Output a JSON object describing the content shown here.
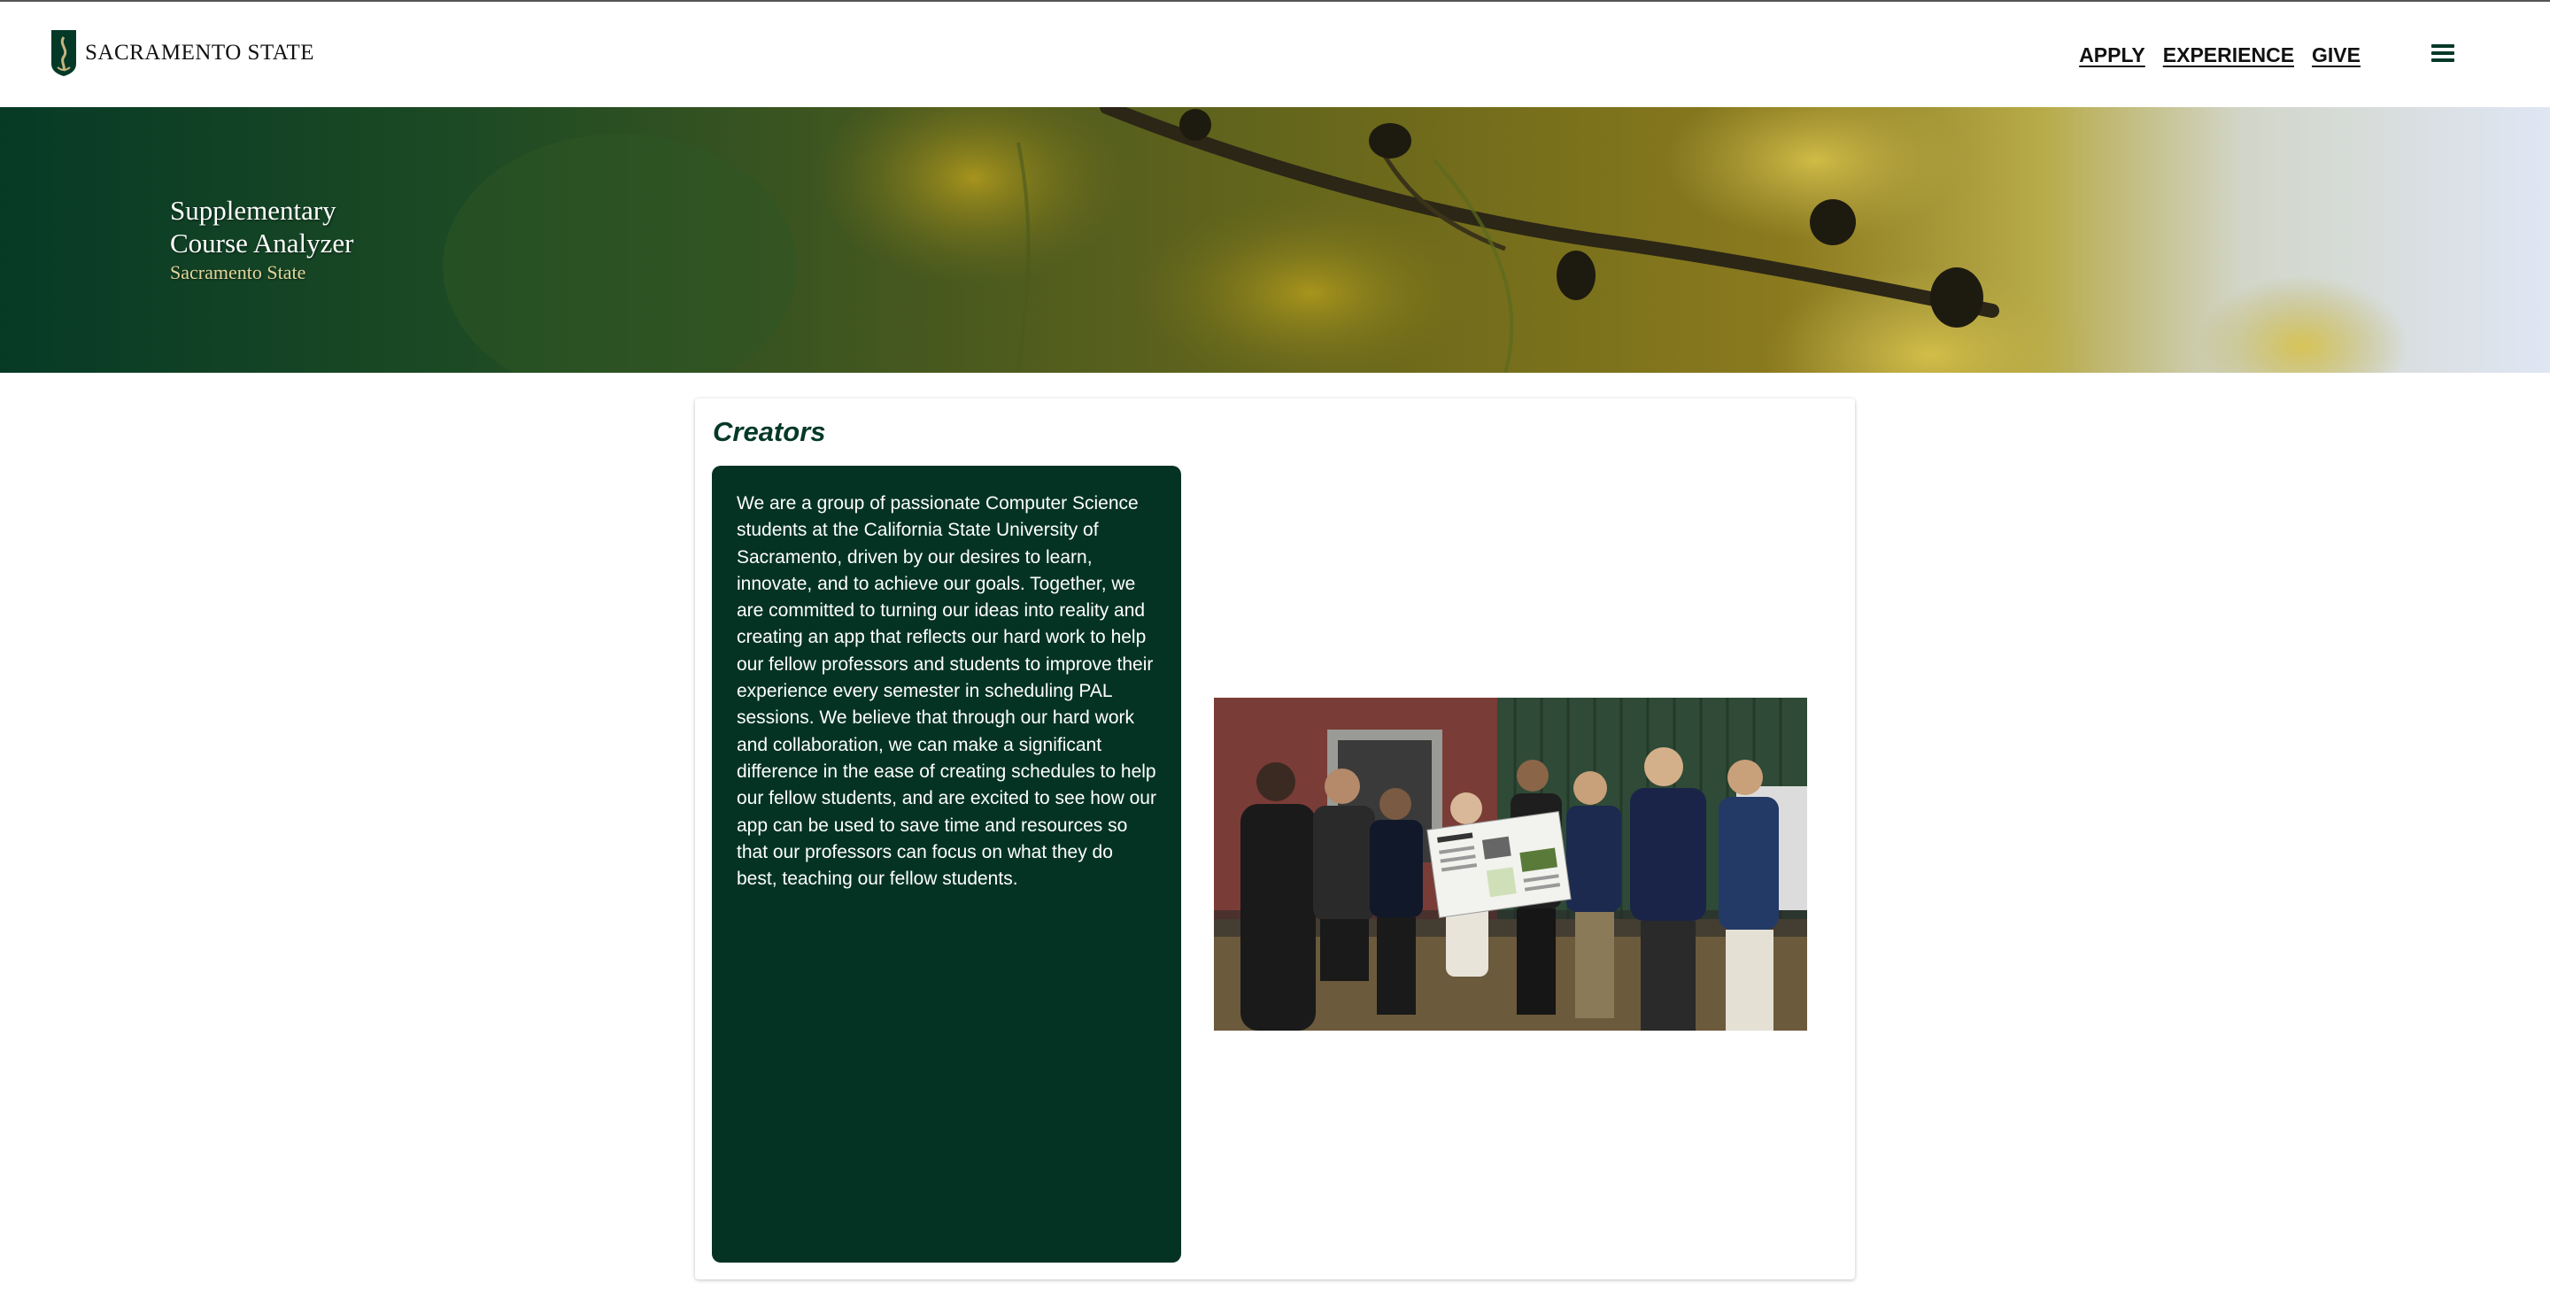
{
  "header": {
    "logo_text": "SACRAMENTO STATE",
    "nav": [
      {
        "label": "APPLY"
      },
      {
        "label": "EXPERIENCE"
      },
      {
        "label": "GIVE"
      }
    ],
    "menu_icon": "hamburger-menu-icon"
  },
  "hero": {
    "title": "Supplementary Course Analyzer",
    "subtitle": "Sacramento State"
  },
  "creators": {
    "heading": "Creators",
    "body": "We are a group of passionate Computer Science students at the California State University of Sacramento, driven by our desires to learn, innovate, and to achieve our goals. Together, we are committed to turning our ideas into reality and creating an app that reflects our hard work to help our fellow professors and students to improve their experience every semester in scheduling PAL sessions. We believe that through our hard work and collaboration, we can make a significant difference in the ease of creating schedules to help our fellow students, and are excited to see how our app can be used to save time and resources so that our professors can focus on what they do best, teaching our fellow students."
  },
  "colors": {
    "brand_green": "#043927",
    "panel_green": "#043324",
    "gold": "#e3d59a"
  }
}
